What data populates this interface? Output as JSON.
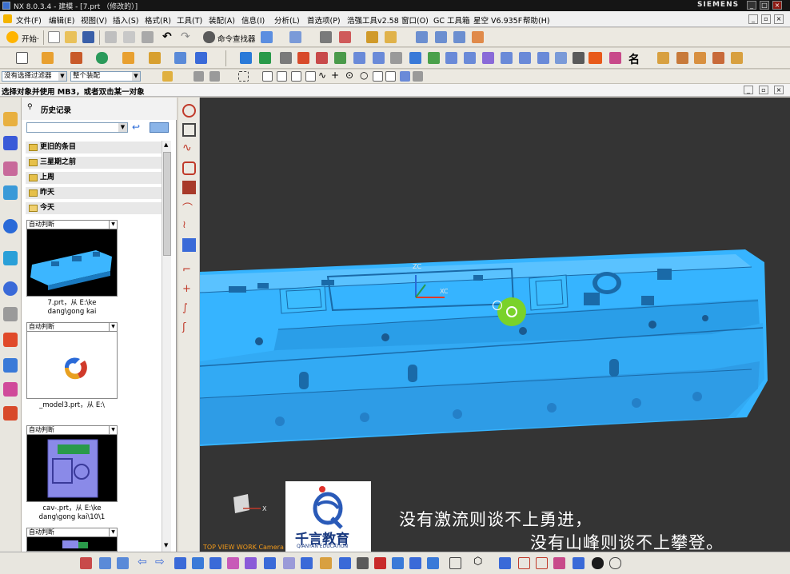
{
  "window": {
    "title": "NX 8.0.3.4 - 建模 - [7.prt （修改的）]",
    "brand": "SIEMENS",
    "controls": [
      "_",
      "□",
      "×"
    ]
  },
  "menu": [
    "文件(F)",
    "编辑(E)",
    "视图(V)",
    "插入(S)",
    "格式(R)",
    "工具(T)",
    "装配(A)",
    "信息(I)",
    "分析(L)",
    "首选项(P)",
    "浩强工具v2.58",
    "窗口(O)",
    "GC 工具箱",
    "星空 V6.935F",
    "帮助(H)"
  ],
  "toolbar": {
    "start_label": "开始·",
    "command_finder_label": "命令查找器"
  },
  "selection_bar": {
    "filter_value": "没有选择过滤器",
    "scope_value": "整个装配"
  },
  "status": {
    "prompt": "选择对象并使用 MB3，或者双击某一对象"
  },
  "history": {
    "title": "历史记录",
    "folders": [
      "更旧的条目",
      "三星期之前",
      "上周",
      "昨天",
      "今天"
    ],
    "cards": [
      {
        "mode": "自动判断",
        "caption_lines": [
          "7.prt，从 E:\\ke",
          "dang\\gong kai"
        ]
      },
      {
        "mode": "自动判断",
        "caption_lines": [
          "_model3.prt，从 E:\\"
        ]
      },
      {
        "mode": "自动判断",
        "caption_lines": [
          "cav-.prt，从 E:\\ke",
          "dang\\gong kai\\10\\1"
        ]
      },
      {
        "mode": "自动判断",
        "caption_lines": []
      }
    ]
  },
  "viewport": {
    "view_label": "TOP VIEW WORK Camera",
    "axis_labels": {
      "x": "XC",
      "z": "ZC"
    },
    "triad_label": "X",
    "model_color": "#36b4ff",
    "background": "#343434"
  },
  "watermark": {
    "name": "千言教育",
    "english": "QIANYAN EDUCATION"
  },
  "subtitles": {
    "line1": "没有激流则谈不上勇进，",
    "line2": "没有山峰则谈不上攀登。"
  }
}
